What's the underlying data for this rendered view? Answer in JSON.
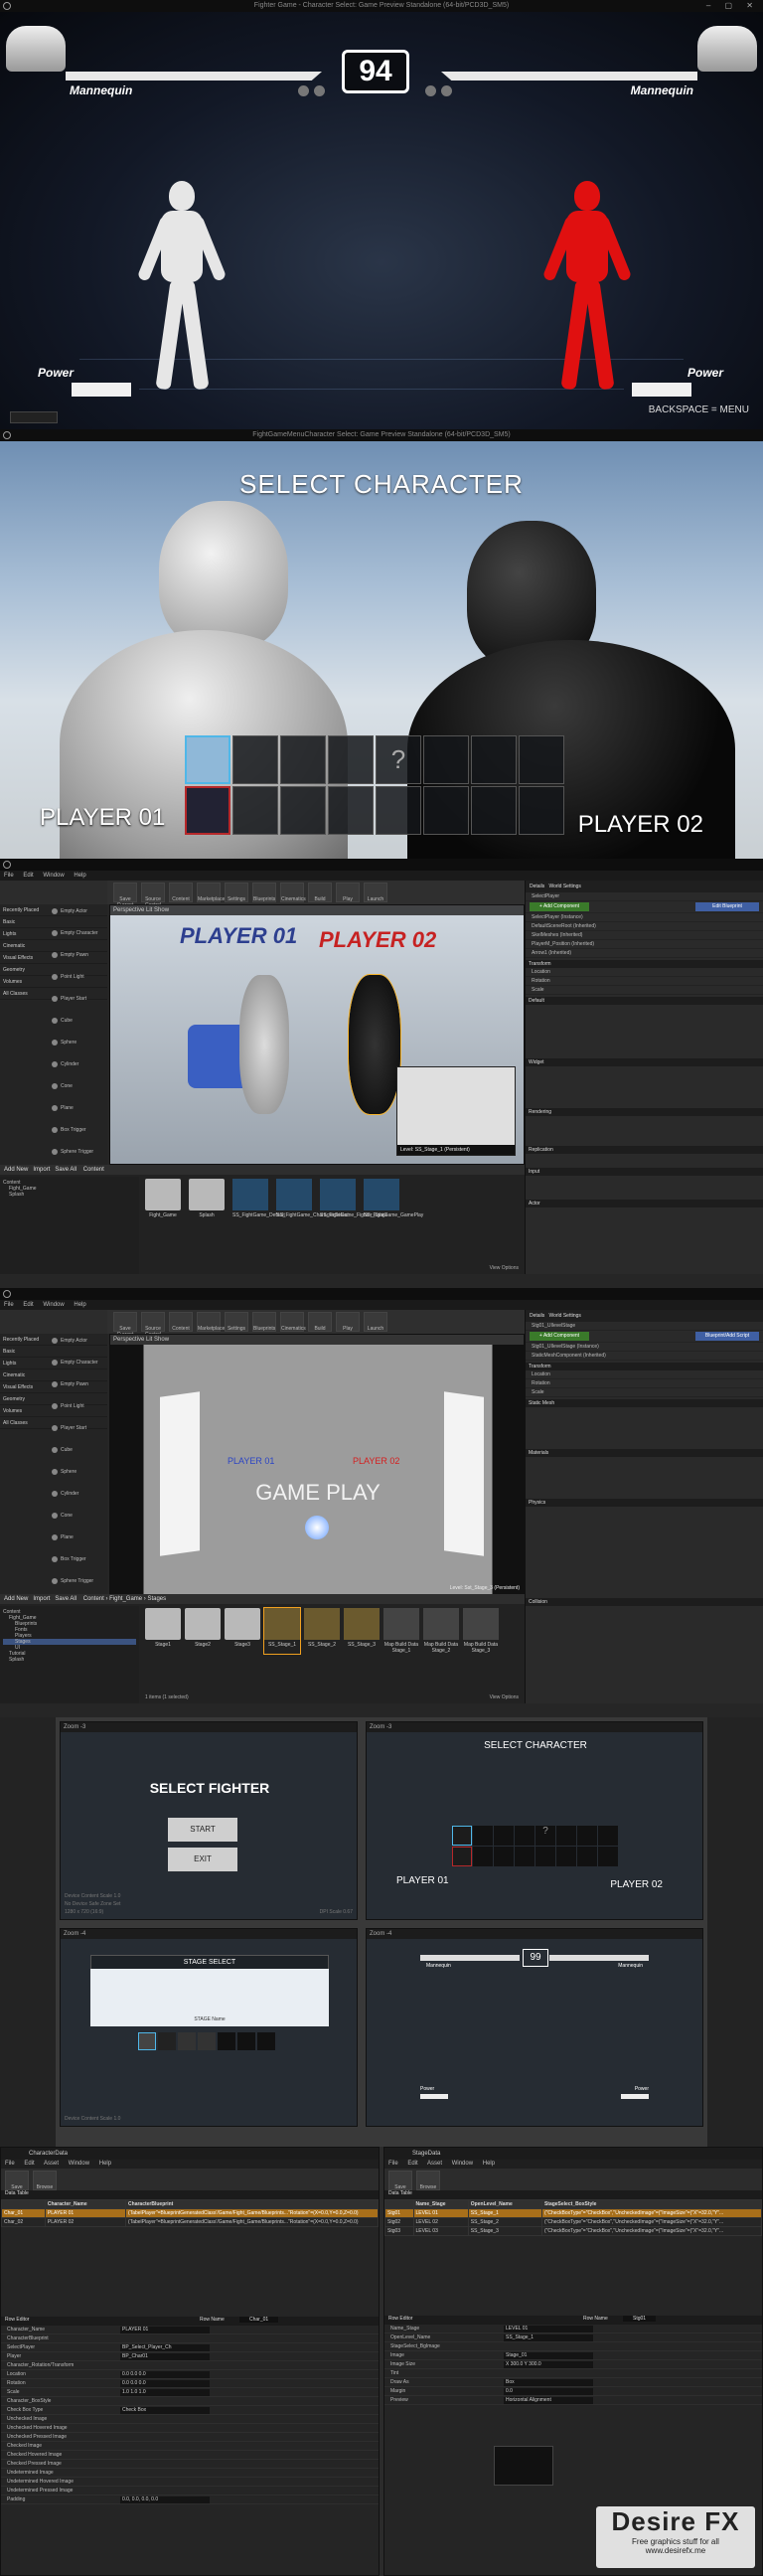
{
  "window_title_1": "Fighter Game - Character Select: Game Preview Standalone (64-bit/PCD3D_SM5)",
  "window_title_2": "FightGameMenuCharacter Select: Game Preview Standalone (64-bit/PCD3D_SM5)",
  "hud": {
    "timer": "94",
    "player_left_name": "Mannequin",
    "player_right_name": "Mannequin",
    "power_left": "Power",
    "power_right": "Power",
    "hint": "BACKSPACE = MENU",
    "health_left": 1.0,
    "health_right": 1.0,
    "power_left_level": 0.3,
    "power_right_level": 0.3,
    "colors": {
      "left_fighter": "#e6e6e6",
      "right_fighter": "#e01010"
    }
  },
  "char_select": {
    "title": "SELECT CHARACTER",
    "player1": "PLAYER 01",
    "player2": "PLAYER 02",
    "unknown_slot": "?",
    "colors": {
      "p1_cursor": "#4fb7e8",
      "p2_cursor": "#b6282a"
    }
  },
  "editor": {
    "menu": [
      "File",
      "Edit",
      "Window",
      "Help"
    ],
    "toolbar": [
      "Save Current",
      "Source Control",
      "Content",
      "Marketplace",
      "Settings",
      "Blueprints",
      "Cinematics",
      "Build",
      "Play",
      "Launch"
    ],
    "modes": "Modes",
    "place_categories": [
      "Recently Placed",
      "Basic",
      "Lights",
      "Cinematic",
      "Visual Effects",
      "Geometry",
      "Volumes",
      "All Classes"
    ],
    "place_items": [
      "Empty Actor",
      "Empty Character",
      "Empty Pawn",
      "Point Light",
      "Player Start",
      "Cube",
      "Sphere",
      "Cylinder",
      "Cone",
      "Plane",
      "Box Trigger",
      "Sphere Trigger"
    ],
    "viewport_bar": "Perspective  Lit  Show",
    "level_1": "Level: SS_Stage_1 (Persistent)",
    "level_2": "Level: Sst_Stage_3 (Persistent)",
    "vp_player1": "PLAYER 01",
    "vp_player2": "PLAYER 02",
    "vp_game_play": "GAME PLAY",
    "details_tab": "Details",
    "world_settings": "World Settings",
    "add_component": "+ Add Component",
    "edit_blueprint": "Edit Blueprint",
    "blueprint_add_script": "Blueprint/Add Script",
    "details_rows_1": [
      "SelectPlayer",
      "SelectPlayer (Instance)",
      "DefaultSceneRoot (Inherited)",
      "SkelMeshes (Inherited)",
      "PlayerM_Position (Inherited)",
      "Arrow1 (Inherited)"
    ],
    "details_rows_2": [
      "Stg01_UIlevelStage",
      "Stg01_UIlevelStage (Instance)",
      "StaticMeshComponent (Inherited)"
    ],
    "sections": [
      "Transform",
      "Default",
      "Widget",
      "Rendering",
      "Replication",
      "Input",
      "Actor"
    ],
    "sections_2": [
      "Transform",
      "Static Mesh",
      "Materials",
      "Physics",
      "Collision"
    ],
    "transform_labels": [
      "Location",
      "Rotation",
      "Scale"
    ],
    "content_title": "Content",
    "content_path_2": "Content  ›  Fight_Game  ›  Stages",
    "add_new": "Add New",
    "import": "Import",
    "save_all": "Save All",
    "view_options": "View Options",
    "tree_1": [
      "Content",
      "Fight_Game",
      "Splash"
    ],
    "tree_2": [
      "Content",
      "Fight_Game",
      "Blueprints",
      "Fonts",
      "Players",
      "Stages",
      "UI",
      "Tutorial",
      "Splash"
    ],
    "assets_1": [
      "Fight_Game",
      "Splash",
      "SS_FightGame_Default",
      "SS_FightGame_CharacterSelect",
      "SS_FightGame_Fighter_Stage",
      "SS_FightGame_GamePlay"
    ],
    "assets_2": [
      "Stage1",
      "Stage2",
      "Stage3",
      "SS_Stage_1",
      "SS_Stage_2",
      "SS_Stage_3",
      "Map Build Data Stage_1",
      "Map Build Data Stage_2",
      "Map Build Data Stage_3"
    ],
    "selected_count": "1 items (1 selected)"
  },
  "umg": {
    "zoom_labels": [
      "Zoom -3",
      "Zoom -3",
      "Zoom -4",
      "Zoom -4"
    ],
    "select_fighter": "SELECT FIGHTER",
    "start": "START",
    "exit": "EXIT",
    "select_character": "SELECT CHARACTER",
    "player1": "PLAYER 01",
    "player2": "PLAYER 02",
    "stage_select": "STAGE SELECT",
    "stage_name": "STAGE Name",
    "timer": "99",
    "power": "Power",
    "mannequin": "Mannequin",
    "device": "Device Content Scale 1.0",
    "dpi": "DPI Scale 0.67",
    "safe_zone": "No Device Safe Zone Set",
    "res": "1280 x 720 (16:9)"
  },
  "datatables": {
    "left_tab": "CharacterData",
    "right_tab": "StageData",
    "menu": [
      "File",
      "Edit",
      "Asset",
      "Window",
      "Help"
    ],
    "tools": [
      "Save",
      "Browse"
    ],
    "data_table": "Data Table",
    "row_editor": "Row Editor",
    "left_cols": [
      "",
      "Character_Name",
      "CharacterBlueprint"
    ],
    "left_rows": [
      [
        "Char_01",
        "PLAYER 01",
        "(TabelPlayer\"=BlueprintGeneratedClass'/Game/Fight_Game/Blueprints...\"Rotation\"=(X=0.0,Y=0.0,Z=0.0)"
      ],
      [
        "Char_02",
        "PLAYER 02",
        "(TabelPlayer\"=BlueprintGeneratedClass'/Game/Fight_Game/Blueprints...\"Rotation\"=(X=0.0,Y=0.0,Z=0.0)"
      ]
    ],
    "right_cols": [
      "",
      "Name_Stage",
      "OpenLevel_Name",
      "StageSelect_BoxStyle"
    ],
    "right_rows": [
      [
        "Stg01",
        "LEVEL 01",
        "SS_Stage_1",
        "(\"CheckBoxType\"=\"CheckBox\",\"UncheckedImage\"=(\"ImageSize\"=(\"X\"=32.0,\"Y\"..."
      ],
      [
        "Stg02",
        "LEVEL 02",
        "SS_Stage_2",
        "(\"CheckBoxType\"=\"CheckBox\",\"UncheckedImage\"=(\"ImageSize\"=(\"X\"=32.0,\"Y\"..."
      ],
      [
        "Stg03",
        "LEVEL 03",
        "SS_Stage_3",
        "(\"CheckBoxType\"=\"CheckBox\",\"UncheckedImage\"=(\"ImageSize\"=(\"X\"=32.0,\"Y\"..."
      ]
    ],
    "row_name_label": "Row Name",
    "left_row_name": "Char_01",
    "right_row_name": "Stg01",
    "left_props": [
      "Character_Name",
      "CharacterBlueprint",
      "SelectPlayer",
      "Player",
      "Character_Rotation/Transform",
      "Location",
      "Rotation",
      "Scale",
      "Character_BoxStyle",
      "Check Box Type",
      "Unchecked Image",
      "Unchecked Hovered Image",
      "Unchecked Pressed Image",
      "Checked Image",
      "Checked Hovered Image",
      "Checked Pressed Image",
      "Undetermined Image",
      "Undetermined Hovered Image",
      "Undetermined Pressed Image",
      "Padding"
    ],
    "left_values": [
      "PLAYER 01",
      "",
      "BP_Select_Player_Ch",
      "BP_Char01",
      "",
      "0.0   0.0   0.0",
      "0.0   0.0   0.0",
      "1.0   1.0   1.0",
      "",
      "Check Box",
      "",
      "",
      "",
      "",
      "",
      "",
      "",
      "",
      "",
      "0.0, 0.0, 0.0, 0.0"
    ],
    "right_props": [
      "Name_Stage",
      "OpenLevel_Name",
      "StageSelect_BgImage",
      "Image",
      "Image Size",
      "Tint",
      "Draw As",
      "Margin",
      "Preview"
    ],
    "right_values": [
      "LEVEL 01",
      "SS_Stage_1",
      "",
      "Stage_01",
      "X 300.0   Y 300.0",
      "",
      "Box",
      "0.0",
      "Horizontal Alignment"
    ],
    "watermark_big": "Desire FX",
    "watermark_small": "Free graphics stuff for all",
    "watermark_url": "www.desirefx.me"
  }
}
